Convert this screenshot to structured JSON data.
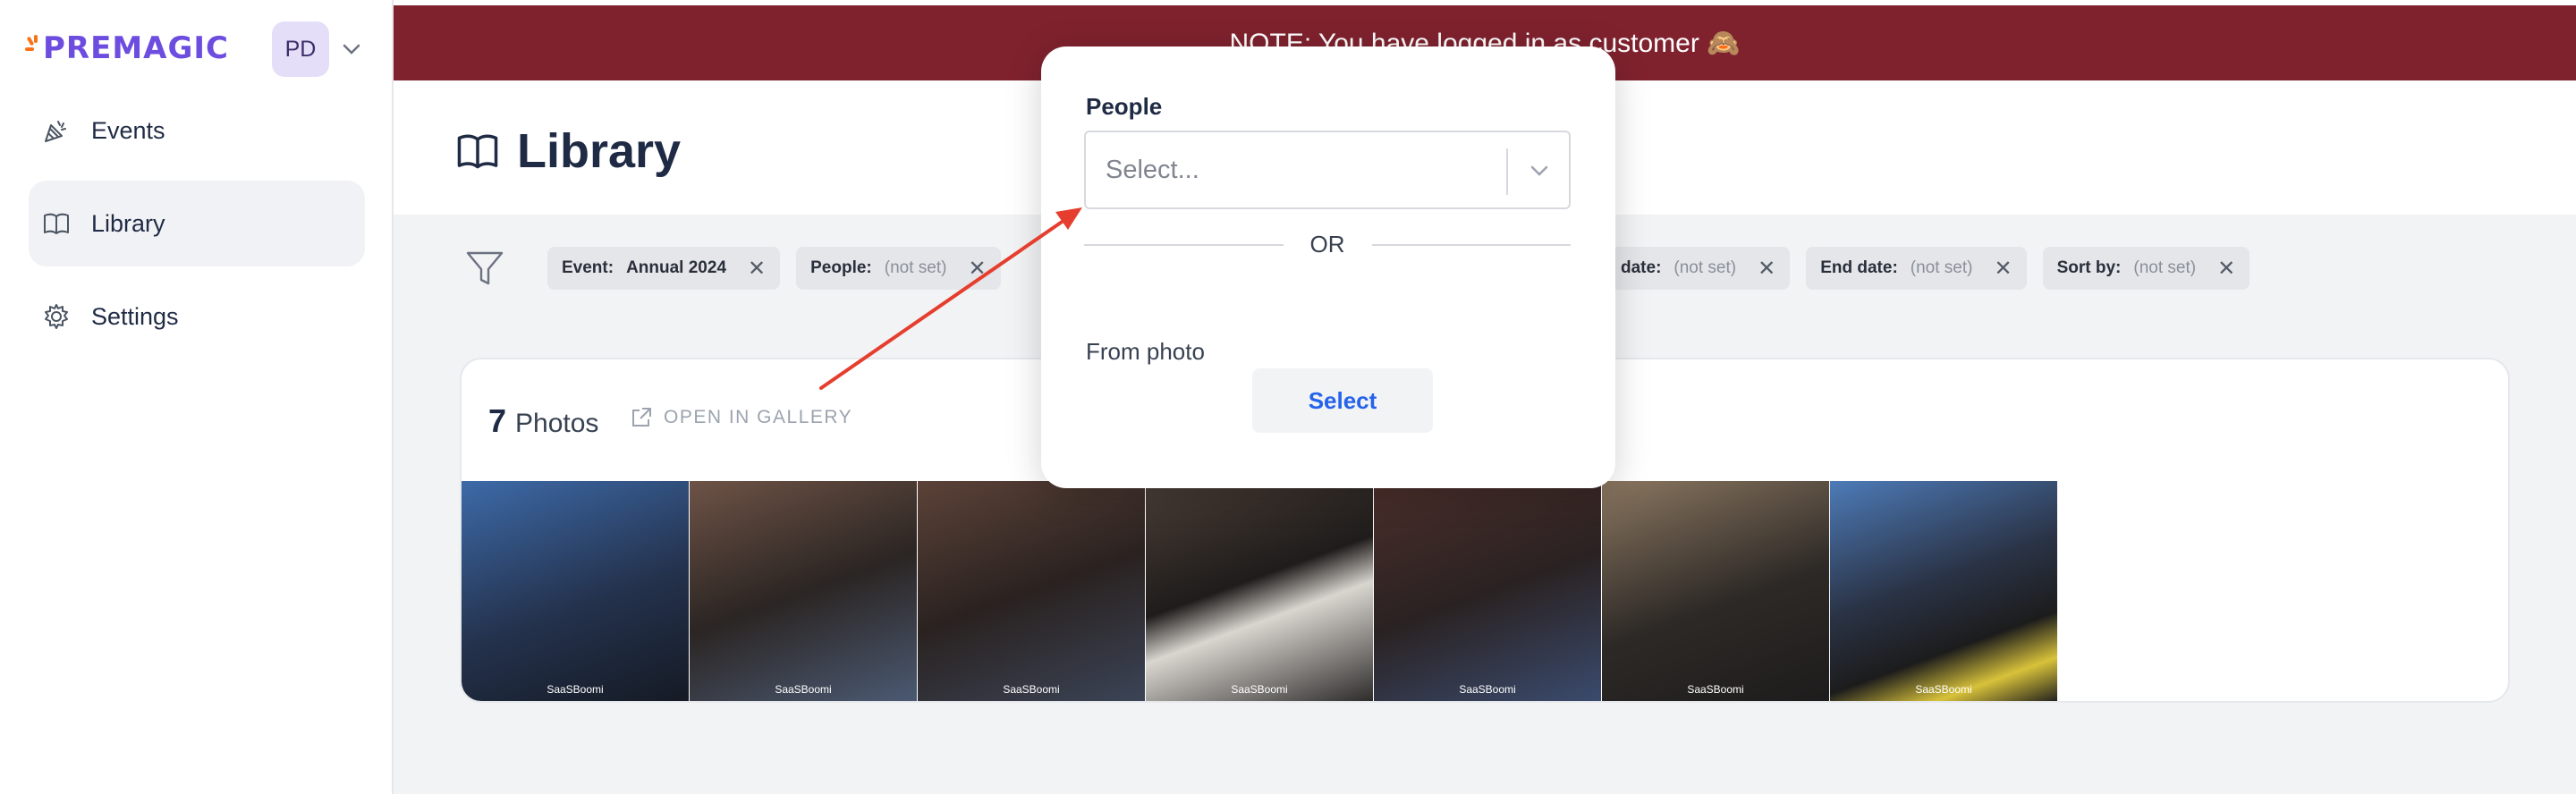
{
  "app": {
    "brand": "PREMAGIC",
    "user_initials": "PD"
  },
  "sidebar": {
    "items": [
      {
        "label": "Events",
        "icon": "events-icon",
        "active": false
      },
      {
        "label": "Library",
        "icon": "book-icon",
        "active": true
      },
      {
        "label": "Settings",
        "icon": "gear-icon",
        "active": false
      }
    ]
  },
  "banner": {
    "text": "NOTE: You have logged in as customer 🙈"
  },
  "page": {
    "title": "Library"
  },
  "filters": {
    "chips": [
      {
        "key": "Event:",
        "value": "Annual 2024"
      },
      {
        "key": "People:",
        "value": "(not set)"
      },
      {
        "key": "date:",
        "value": "(not set)"
      },
      {
        "key": "End date:",
        "value": "(not set)"
      },
      {
        "key": "Sort by:",
        "value": "(not set)"
      }
    ]
  },
  "photos": {
    "count": "7",
    "label": "Photos",
    "open_gallery": "OPEN IN GALLERY",
    "watermark": "SaaSBoomi",
    "thumbs": [
      {
        "bg": "#2f4a77"
      },
      {
        "bg": "#5a3f36"
      },
      {
        "bg": "#4e3a33"
      },
      {
        "bg": "#3b3430"
      },
      {
        "bg": "#3a2c2a"
      },
      {
        "bg": "#6b5a48"
      },
      {
        "bg": "#3b5c8a"
      }
    ]
  },
  "popover": {
    "people_label": "People",
    "select_placeholder": "Select...",
    "or_text": "OR",
    "from_photo_label": "From photo",
    "select_button": "Select"
  },
  "colors": {
    "banner": "#7f222e",
    "brand": "#6d4ce0",
    "accent_link": "#2563eb",
    "annotation_arrow": "#e53e2e"
  }
}
